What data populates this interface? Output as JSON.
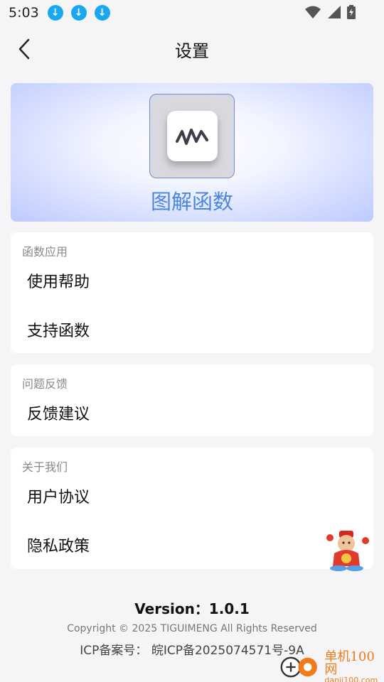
{
  "status_bar": {
    "time": "5:03",
    "notification_icons": [
      "download-icon",
      "download-icon",
      "download-icon"
    ]
  },
  "header": {
    "title": "设置",
    "back_icon": "chevron-left-icon"
  },
  "banner": {
    "app_name": "图解函数",
    "app_icon": "wave-icon",
    "accent": "#4b86e0"
  },
  "sections": [
    {
      "header": "函数应用",
      "items": [
        "使用帮助",
        "支持函数"
      ]
    },
    {
      "header": "问题反馈",
      "items": [
        "反馈建议"
      ]
    },
    {
      "header": "关于我们",
      "items": [
        "用户协议",
        "隐私政策"
      ]
    }
  ],
  "footer": {
    "version": "Version：1.0.1",
    "copyright": "Copyright © 2025 TIGUIMENG All Rights Reserved",
    "icp": "ICP备案号： 皖ICP备2025074571号-9A"
  },
  "watermark": {
    "main": "单机100网",
    "url": "danji100.com"
  }
}
